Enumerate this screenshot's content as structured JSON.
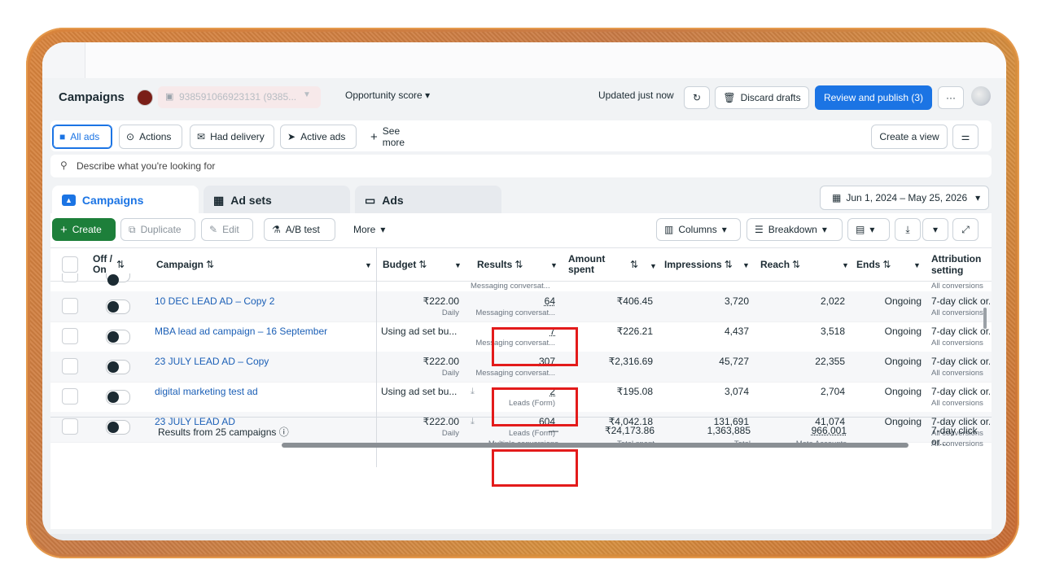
{
  "header": {
    "title": "Campaigns",
    "account_label": "938591066923131 (9385...",
    "opportunity_label": "Opportunity score",
    "updated_text": "Updated just now",
    "discard_label": "Discard drafts",
    "review_label": "Review and publish (3)",
    "more_label": "···"
  },
  "filters": {
    "chips": [
      {
        "label": "All ads",
        "icon": "folder-icon"
      },
      {
        "label": "Actions",
        "icon": "actions-icon"
      },
      {
        "label": "Had delivery",
        "icon": "delivery-icon"
      },
      {
        "label": "Active ads",
        "icon": "send-icon"
      },
      {
        "label": "See more",
        "icon": "plus-icon"
      }
    ],
    "create_view_label": "Create a view",
    "search_placeholder": "Describe what you're looking for"
  },
  "level_tabs": [
    {
      "label": "Campaigns",
      "icon": "campaign-icon"
    },
    {
      "label": "Ad sets",
      "icon": "grid-icon"
    },
    {
      "label": "Ads",
      "icon": "ad-icon"
    }
  ],
  "date_range": "Jun 1, 2024 – May 25, 2026",
  "toolbar": {
    "create": "Create",
    "duplicate": "Duplicate",
    "edit": "Edit",
    "ab_test": "A/B test",
    "more": "More",
    "columns": "Columns",
    "breakdown": "Breakdown"
  },
  "table": {
    "headers": {
      "offon": "Off / On",
      "campaign": "Campaign",
      "budget": "Budget",
      "results": "Results",
      "amount": "Amount spent",
      "impressions": "Impressions",
      "reach": "Reach",
      "ends": "Ends",
      "attribution": "Attribution setting"
    },
    "top_partial": {
      "results_sub": "Messaging conversat...",
      "attribution_sub": "All conversions"
    },
    "rows": [
      {
        "name": "10 DEC LEAD AD – Copy 2",
        "budget": "₹222.00",
        "budget_sub": "Daily",
        "results": "64",
        "results_sub": "Messaging conversat...",
        "amount": "₹406.45",
        "impressions": "3,720",
        "reach": "2,022",
        "ends": "Ongoing",
        "attribution": "7-day click or...",
        "attribution_sub": "All conversions"
      },
      {
        "name": "MBA lead ad campaign – 16 September",
        "budget": "Using ad set bu...",
        "budget_sub": "",
        "results": "7",
        "results_sub": "Messaging conversat...",
        "amount": "₹226.21",
        "impressions": "4,437",
        "reach": "3,518",
        "ends": "Ongoing",
        "attribution": "7-day click or...",
        "attribution_sub": "All conversions"
      },
      {
        "name": "23 JULY LEAD AD – Copy",
        "budget": "₹222.00",
        "budget_sub": "Daily",
        "results": "307",
        "results_sub": "Messaging conversat...",
        "amount": "₹2,316.69",
        "impressions": "45,727",
        "reach": "22,355",
        "ends": "Ongoing",
        "attribution": "7-day click or...",
        "attribution_sub": "All conversions"
      },
      {
        "name": "digital marketing test ad",
        "budget": "Using ad set bu...",
        "budget_sub": "",
        "results": "2",
        "results_sub": "Leads (Form)",
        "amount": "₹195.08",
        "impressions": "3,074",
        "reach": "2,704",
        "ends": "Ongoing",
        "attribution": "7-day click or...",
        "attribution_sub": "All conversions"
      },
      {
        "name": "23 JULY LEAD AD",
        "budget": "₹222.00",
        "budget_sub": "Daily",
        "results": "604",
        "results_sub": "Leads (Form)",
        "amount": "₹4,042.18",
        "impressions": "131,691",
        "reach": "41,074",
        "ends": "Ongoing",
        "attribution": "7-day click or...",
        "attribution_sub": "All conversions"
      }
    ],
    "summary": {
      "label": "Results from 25 campaigns",
      "results": "—",
      "results_sub": "Multiple conversions",
      "amount": "₹24,173.86",
      "amount_sub": "Total spent",
      "impressions": "1,363,885",
      "impressions_sub": "Total",
      "reach": "966,001",
      "reach_sub": "Meta Accounts",
      "attribution": "7-day click or...",
      "attribution_sub": "All conversions"
    }
  },
  "colors": {
    "primary": "#1b74e4",
    "create_green": "#1d7f3a",
    "highlight_red": "#e31b1b",
    "link_blue": "#1b5fb6"
  }
}
